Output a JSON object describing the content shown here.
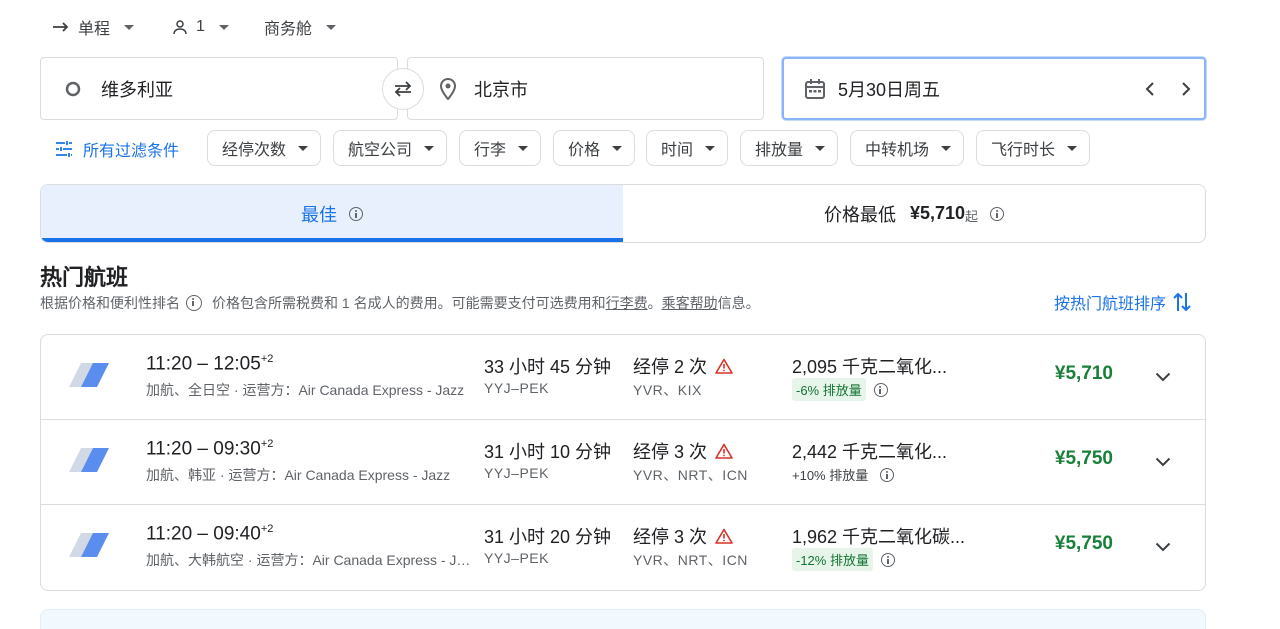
{
  "top": {
    "trip_type": "单程",
    "passengers": "1",
    "cabin": "商务舱"
  },
  "search": {
    "origin": "维多利亚",
    "destination": "北京市",
    "date": "5月30日周五"
  },
  "filters": {
    "all_filters": "所有过滤条件",
    "chips": [
      "经停次数",
      "航空公司",
      "行李",
      "价格",
      "时间",
      "排放量",
      "中转机场",
      "飞行时长"
    ]
  },
  "tabs": {
    "best": "最佳",
    "cheapest_label": "价格最低",
    "cheapest_price": "¥5,710",
    "cheapest_suffix": "起"
  },
  "section": {
    "title": "热门航班",
    "rank_note": "根据价格和便利性排名",
    "price_note_1": "价格包含所需税费和 1 名成人的费用。可能需要支付可选费用和",
    "baggage_fee_link": "行李费",
    "price_note_2": "。",
    "passenger_help_link": "乘客帮助",
    "price_note_3": "信息。",
    "sort_label": "按热门航班排序"
  },
  "flights": [
    {
      "depart": "11:20",
      "arrive": "12:05",
      "plus_days": "+2",
      "airlines": "加航、全日空 · 运营方：Air Canada Express - Jazz",
      "duration": "33 小时 45 分钟",
      "route": "YYJ–PEK",
      "stops": "经停 2 次",
      "stop_airports": "YVR、KIX",
      "co2": "2,095 千克二氧化...",
      "emissions": "-6% 排放量",
      "emissions_good": true,
      "price": "¥5,710"
    },
    {
      "depart": "11:20",
      "arrive": "09:30",
      "plus_days": "+2",
      "airlines": "加航、韩亚 · 运营方：Air Canada Express - Jazz",
      "duration": "31 小时 10 分钟",
      "route": "YYJ–PEK",
      "stops": "经停 3 次",
      "stop_airports": "YVR、NRT、ICN",
      "co2": "2,442 千克二氧化...",
      "emissions": "+10% 排放量",
      "emissions_good": false,
      "price": "¥5,750"
    },
    {
      "depart": "11:20",
      "arrive": "09:40",
      "plus_days": "+2",
      "airlines": "加航、大韩航空 · 运营方：Air Canada Express - Jazz",
      "duration": "31 小时 20 分钟",
      "route": "YYJ–PEK",
      "stops": "经停 3 次",
      "stop_airports": "YVR、NRT、ICN",
      "co2": "1,962 千克二氧化碳...",
      "emissions": "-12% 排放量",
      "emissions_good": true,
      "price": "¥5,750"
    }
  ],
  "colors": {
    "accent": "#1a73e8",
    "price_green": "#188038",
    "warning": "#d93025"
  }
}
